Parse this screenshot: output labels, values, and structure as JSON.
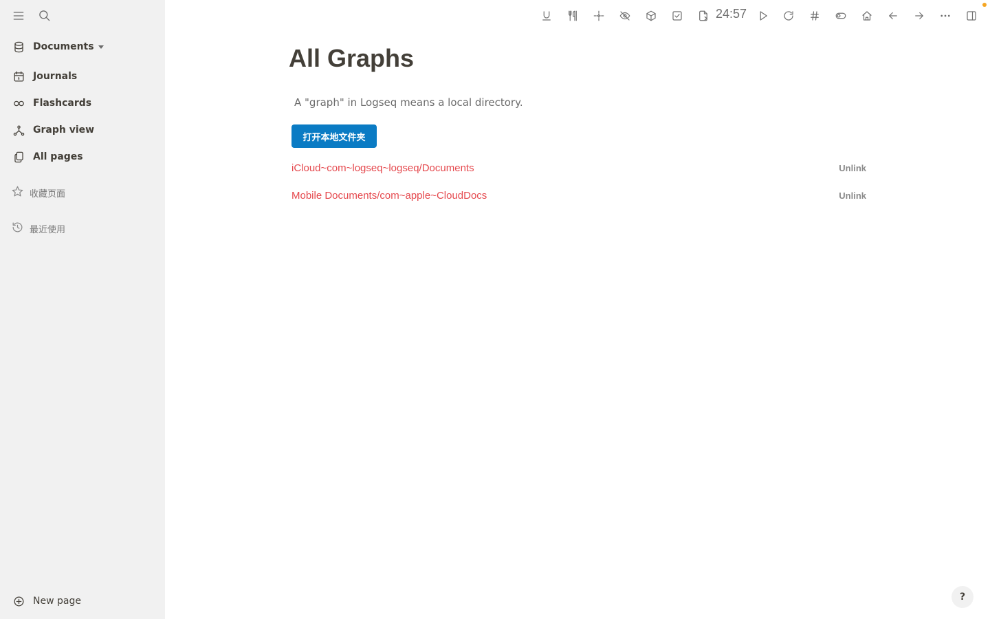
{
  "sidebar": {
    "repo_label": "Documents",
    "nav": [
      {
        "label": "Journals",
        "icon": "calendar-icon"
      },
      {
        "label": "Flashcards",
        "icon": "infinity-icon"
      },
      {
        "label": "Graph view",
        "icon": "graph-icon"
      },
      {
        "label": "All pages",
        "icon": "pages-icon"
      }
    ],
    "favorites_label": "收藏页面",
    "recent_label": "最近使用",
    "new_page_label": "New page"
  },
  "toolbar": {
    "icons": [
      "underline-icon",
      "utensils-icon",
      "sparkle-icon",
      "eye-off-icon",
      "cube-icon",
      "checkbox-icon",
      "file-export-icon",
      "play-icon",
      "refresh-icon",
      "hashtag-icon",
      "toggle-icon",
      "home-icon",
      "arrow-left-icon",
      "arrow-right-icon",
      "more-icon",
      "sidebar-right-icon"
    ],
    "timer": "24:57",
    "notification_color": "#f5a623"
  },
  "main": {
    "title": "All Graphs",
    "description": "A \"graph\" in Logseq means a local directory.",
    "open_button": "打开本地文件夹",
    "graphs": [
      {
        "name": "iCloud~com~logseq~logseq/Documents",
        "action": "Unlink"
      },
      {
        "name": "Mobile Documents/com~apple~CloudDocs",
        "action": "Unlink"
      }
    ]
  },
  "help_label": "?",
  "colors": {
    "accent": "#0a7bc4",
    "link": "#e5484d",
    "sidebar_bg": "#f1f1f1"
  }
}
